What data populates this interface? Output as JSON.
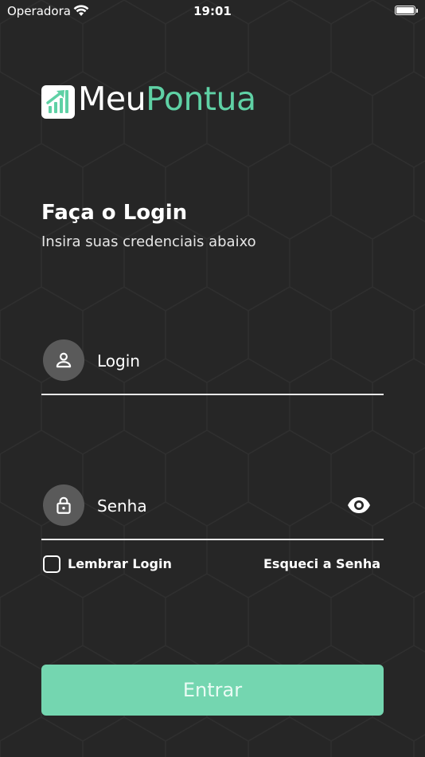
{
  "status_bar": {
    "carrier": "Operadora",
    "time": "19:01"
  },
  "brand": {
    "name_part1": "Meu",
    "name_part2": "Pontua",
    "accent_color": "#5fd1a5"
  },
  "login_screen": {
    "title": "Faça o Login",
    "subtitle": "Insira suas credenciais abaixo",
    "login_field": {
      "placeholder": "Login",
      "value": "",
      "icon": "user-icon"
    },
    "password_field": {
      "placeholder": "Senha",
      "value": "",
      "icon": "lock-icon",
      "toggle_icon": "eye-icon"
    },
    "remember_label": "Lembrar Login",
    "remember_checked": false,
    "forgot_label": "Esqueci a Senha",
    "submit_label": "Entrar",
    "button_color": "#74d6b0"
  }
}
